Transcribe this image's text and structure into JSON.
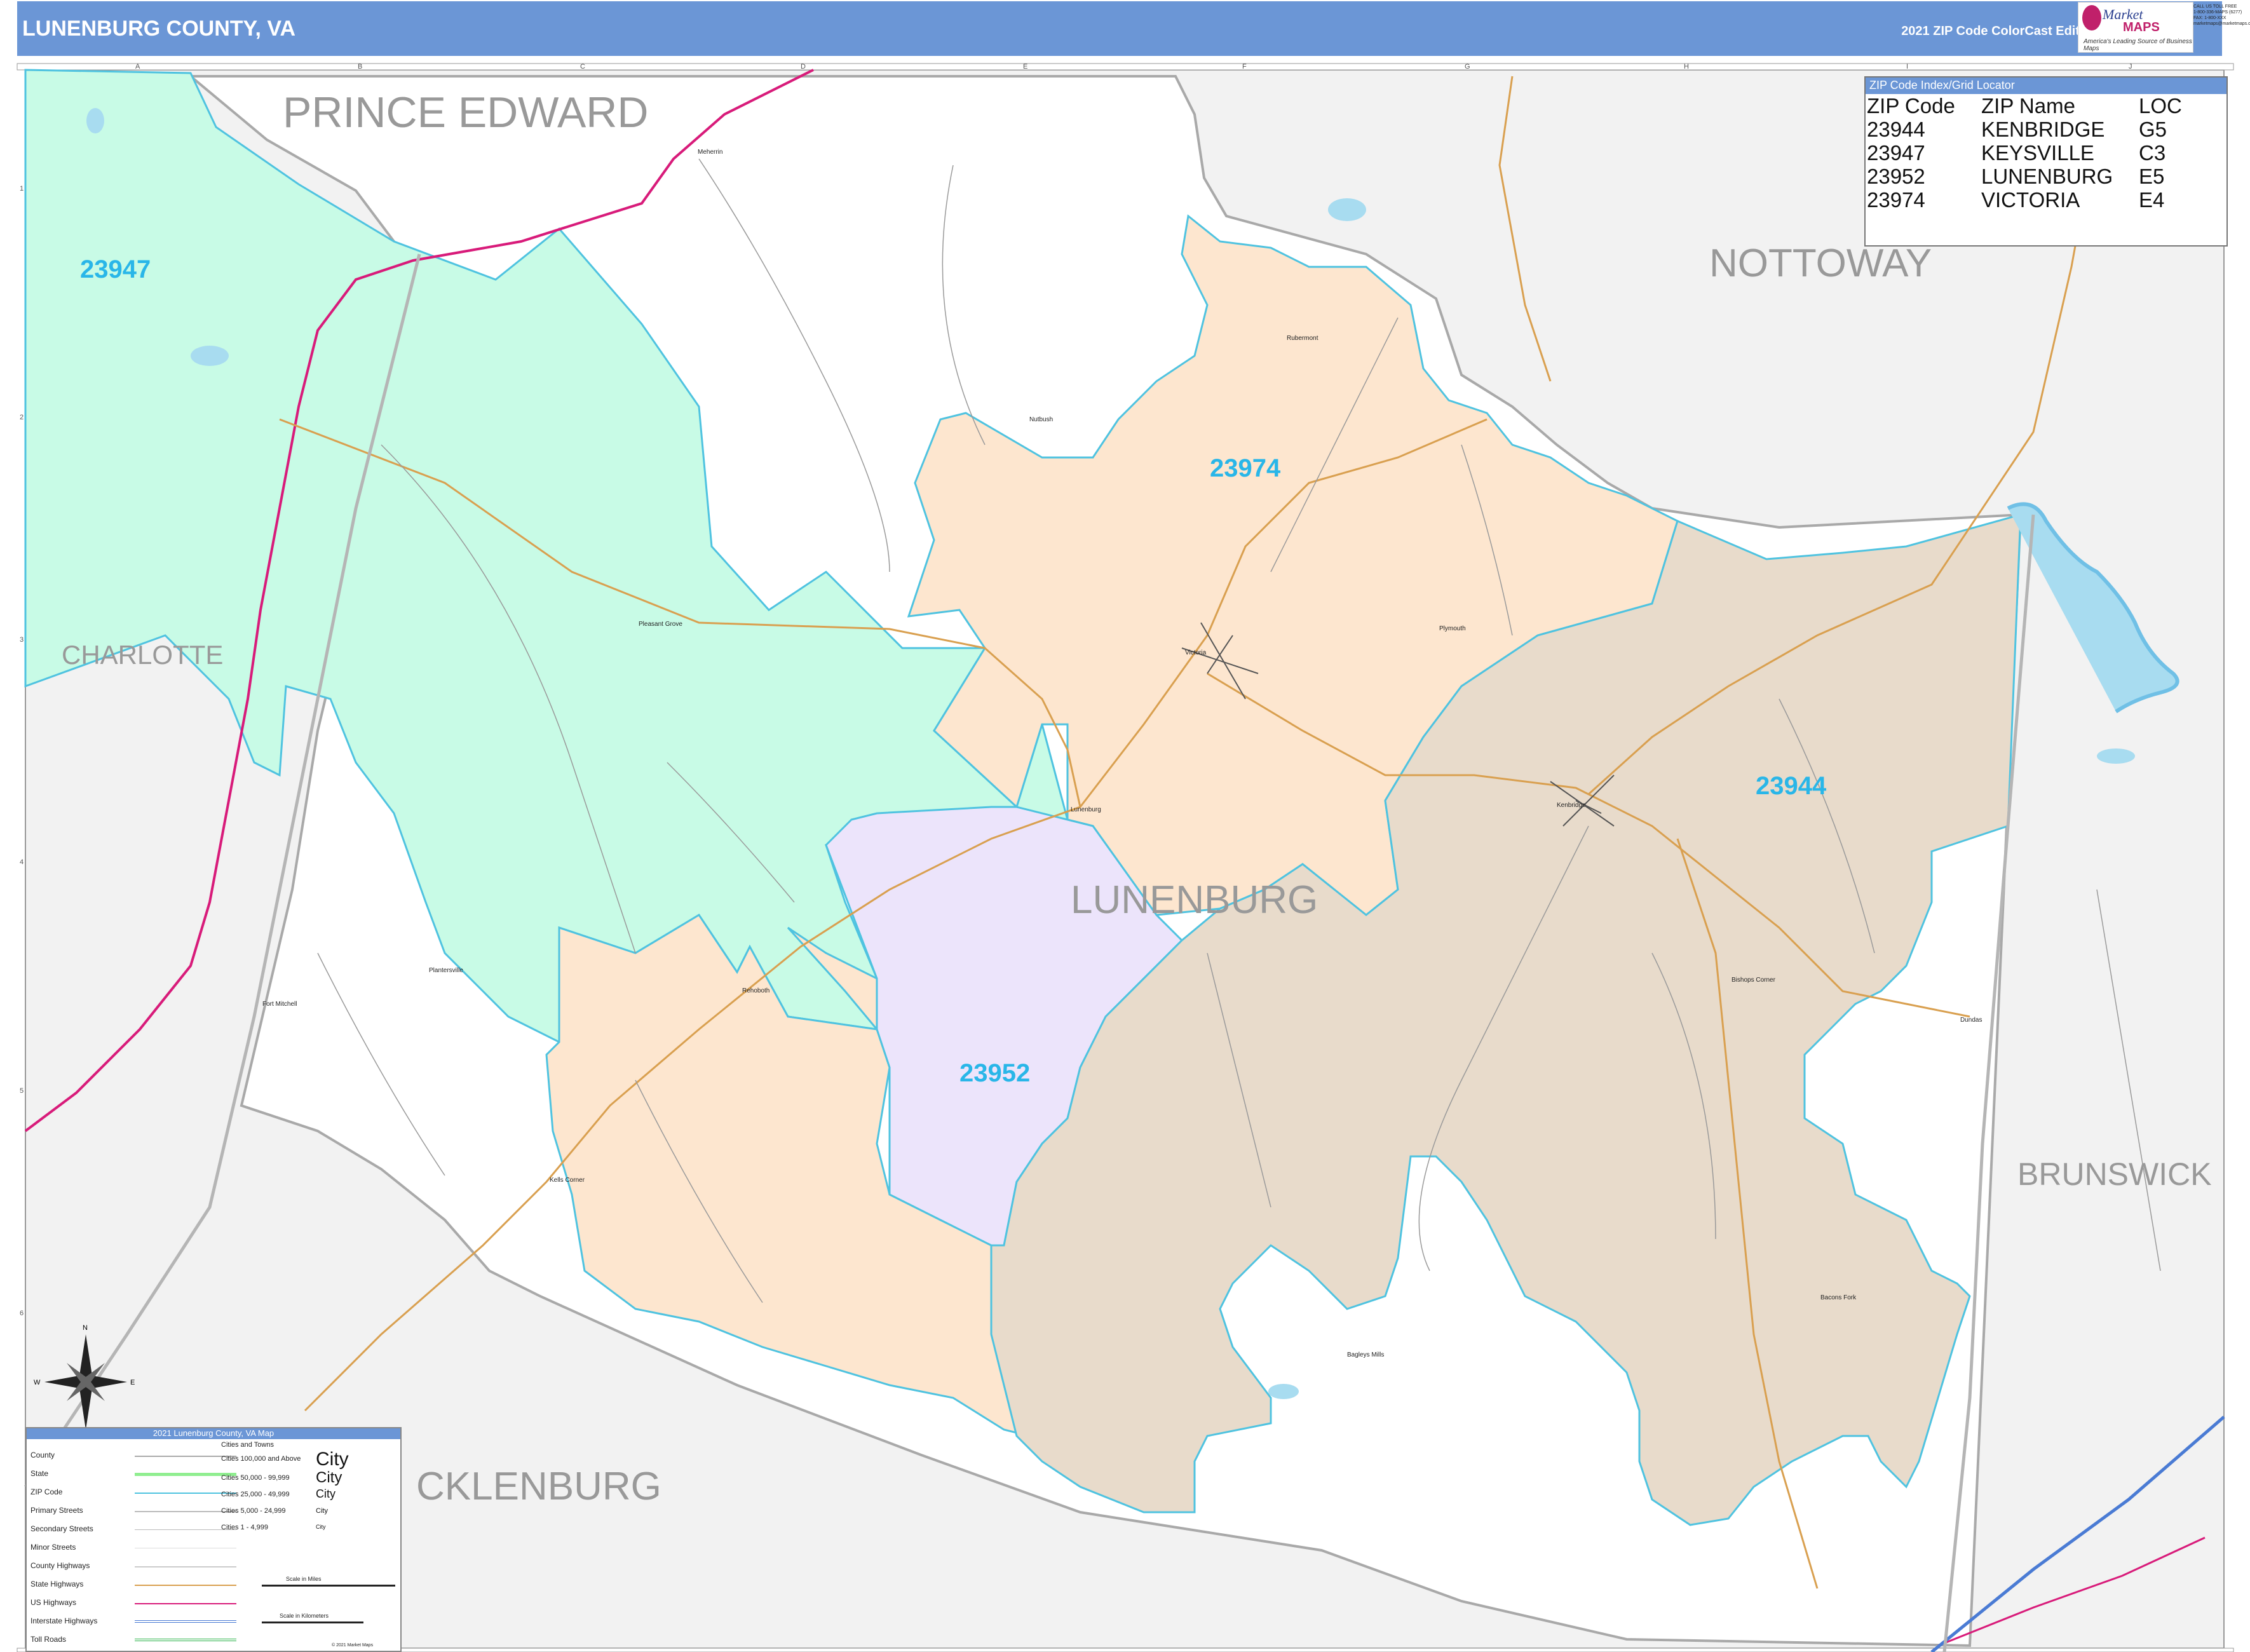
{
  "header": {
    "title": "LUNENBURG COUNTY, VA",
    "edition": "2021 ZIP Code ColorCast Edition",
    "logo": {
      "brand_top": "Market",
      "brand_bottom": "MAPS",
      "tagline": "America's Leading Source of Business Maps"
    },
    "contact": [
      "CALL US TOLL FREE",
      "1-800-336-MAPS (6277)",
      "FAX: 1-800-XXX",
      "marketmaps@marketmaps.com"
    ]
  },
  "grid": {
    "columns": [
      "A",
      "B",
      "C",
      "D",
      "E",
      "F",
      "G",
      "H",
      "I",
      "J"
    ],
    "rows": [
      "1",
      "2",
      "3",
      "4",
      "5",
      "6"
    ]
  },
  "counties": {
    "prince_edward": "PRINCE EDWARD",
    "nottoway": "NOTTOWAY",
    "charlotte": "CHARLOTTE",
    "brunswick": "BRUNSWICK",
    "mecklenburg": "CKLENBURG",
    "lunenburg": "LUNENBURG"
  },
  "zip_labels": {
    "z23947": "23947",
    "z23974": "23974",
    "z23944": "23944",
    "z23952": "23952"
  },
  "places": {
    "meherrin": "Meherrin",
    "rubermont": "Rubermont",
    "nutbush": "Nutbush",
    "pleasant_grove": "Pleasant Grove",
    "victoria": "Victoria",
    "plymouth": "Plymouth",
    "lunenburg": "Lunenburg",
    "kenbridge": "Kenbridge",
    "bishops_corner": "Bishops Corner",
    "dundas": "Dundas",
    "plantersville": "Plantersville",
    "fort_mitchell": "Fort Mitchell",
    "rehoboth": "Rehoboth",
    "kelis_corner": "Kells Corner",
    "bacons_fork": "Bacons Fork",
    "bagleys_mills": "Bagleys Mills"
  },
  "zip_index": {
    "title": "ZIP Code Index/Grid Locator",
    "columns": [
      "ZIP Code",
      "ZIP Name",
      "LOC"
    ],
    "rows": [
      [
        "23944",
        "KENBRIDGE",
        "G5"
      ],
      [
        "23947",
        "KEYSVILLE",
        "C3"
      ],
      [
        "23952",
        "LUNENBURG",
        "E5"
      ],
      [
        "23974",
        "VICTORIA",
        "E4"
      ]
    ]
  },
  "legend": {
    "title": "2021 Lunenburg County, VA Map",
    "items": [
      "County",
      "State",
      "ZIP Code",
      "Primary Streets",
      "Secondary Streets",
      "Minor Streets",
      "County Highways",
      "State Highways",
      "US Highways",
      "Interstate Highways",
      "Toll Roads"
    ],
    "cities_header": "Cities and Towns",
    "city_classes": [
      "Cities 100,000 and Above",
      "Cities 50,000 - 99,999",
      "Cities 25,000 - 49,999",
      "Cities 5,000 - 24,999",
      "Cities 1 - 4,999"
    ],
    "city_symbols": [
      "City",
      "City",
      "City",
      "City",
      "City"
    ],
    "scale_miles": "Scale in Miles",
    "scale_km": "Scale in Kilometers",
    "copyright": "© 2021 Market Maps"
  },
  "compass": {
    "n": "N",
    "s": "S",
    "e": "E",
    "w": "W"
  },
  "colors": {
    "z23947": "#c8fbe6",
    "z23974": "#fde6cf",
    "z23944": "#e8dbcb",
    "z23952": "#ece4fb",
    "outside": "#f2f2f2",
    "zip_border": "#4fc3e0",
    "us_highway": "#d81b7a",
    "state_highway": "#d9a050",
    "header": "#6b96d6",
    "zip_text": "#29b6e8"
  }
}
